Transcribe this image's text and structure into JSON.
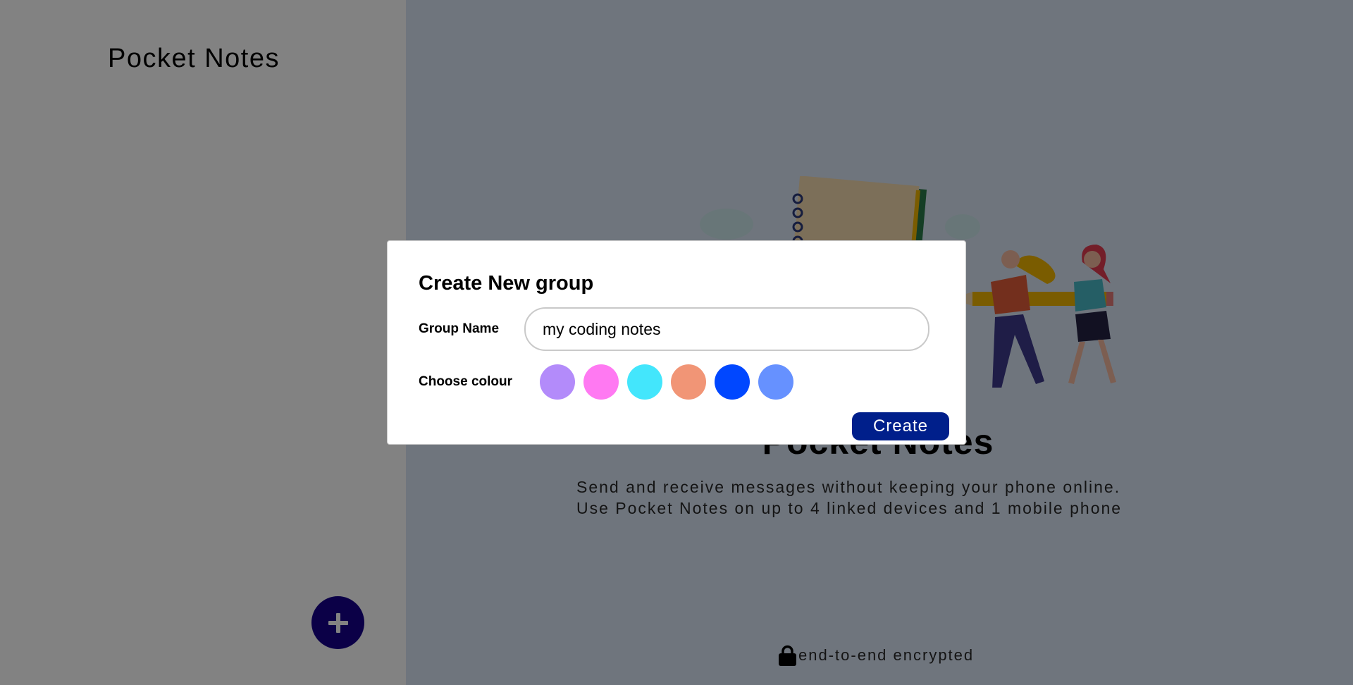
{
  "sidebar": {
    "app_title": "Pocket Notes",
    "add_button_icon": "plus-icon"
  },
  "main": {
    "title": "Pocket Notes",
    "description_line1": "Send and receive messages without keeping your phone online.",
    "description_line2": "Use Pocket Notes on up to 4 linked devices and 1 mobile phone",
    "encryption_text": "end-to-end encrypted",
    "encryption_icon": "lock-icon"
  },
  "modal": {
    "title": "Create New group",
    "group_name_label": "Group Name",
    "group_name_value": "my coding notes",
    "colour_label": "Choose colour",
    "colours": [
      "#b38bfa",
      "#ff79f2",
      "#43e6fc",
      "#f19576",
      "#0047ff",
      "#6691ff"
    ],
    "create_label": "Create"
  }
}
